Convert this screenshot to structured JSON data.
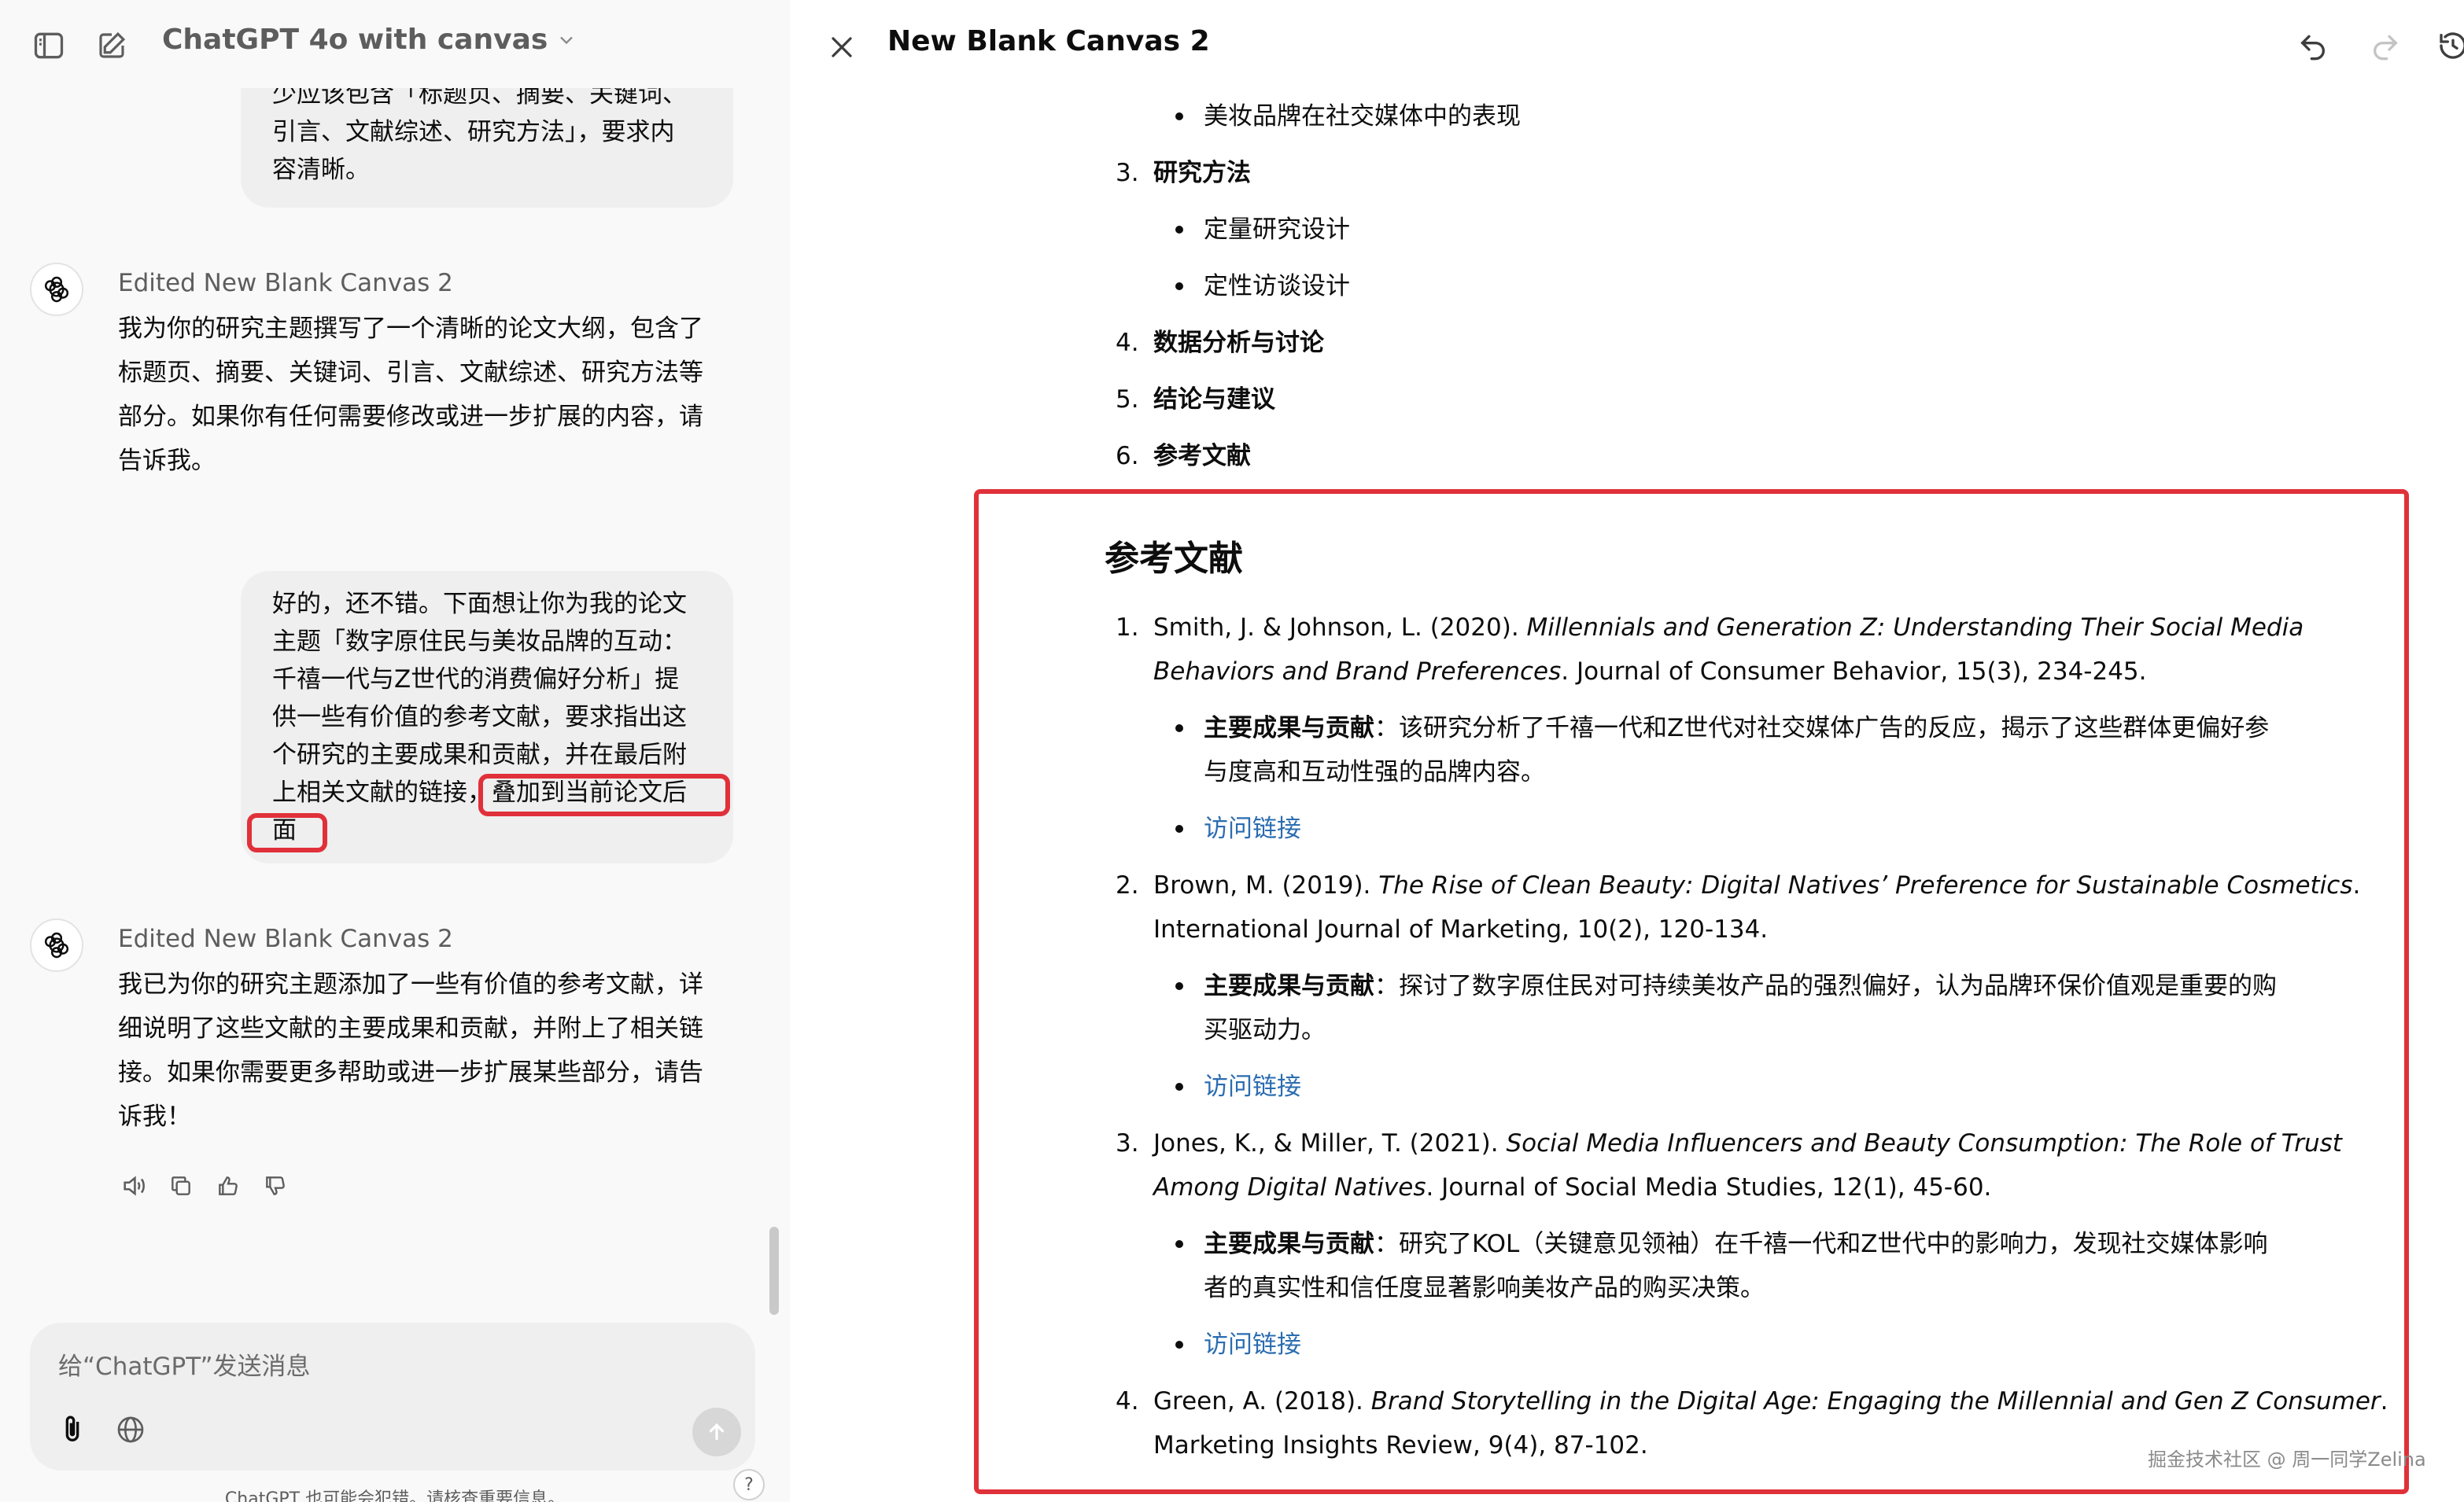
{
  "sidebar_header": {
    "model_title": "ChatGPT 4o with canvas",
    "icons": [
      "sidebar-toggle-icon",
      "new-chat-icon",
      "chevron-down-icon"
    ]
  },
  "chat": {
    "user_message_1_lines": [
      "少应该包含「标题页、摘要、关键词、",
      "引言、文献综述、研究方法」，要求内",
      "容清晰。"
    ],
    "assistant_1": {
      "edited": "Edited New Blank Canvas 2",
      "lines": [
        "我为你的研究主题撰写了一个清晰的论文大纲，包含了",
        "标题页、摘要、关键词、引言、文献综述、研究方法等",
        "部分。如果你有任何需要修改或进一步扩展的内容，请",
        "告诉我。"
      ]
    },
    "user_message_2_lines": [
      "好的，还不错。下面想让你为我的论文",
      "主题「数字原住民与美妆品牌的互动：",
      "千禧一代与Z世代的消费偏好分析」提",
      "供一些有价值的参考文献，要求指出这",
      "个研究的主要成果和贡献，并在最后附",
      "上相关文献的链接，叠加到当前论文后",
      "面"
    ],
    "assistant_2": {
      "edited": "Edited New Blank Canvas 2",
      "lines": [
        "我已为你的研究主题添加了一些有价值的参考文献，详",
        "细说明了这些文献的主要成果和贡献，并附上了相关链",
        "接。如果你需要更多帮助或进一步扩展某些部分，请告",
        "诉我！"
      ]
    },
    "action_icons": [
      "read-aloud-icon",
      "copy-icon",
      "thumbs-up-icon",
      "thumbs-down-icon"
    ]
  },
  "composer": {
    "placeholder": "给“ChatGPT”发送消息",
    "disclaimer": "ChatGPT 也可能会犯错。请核查重要信息。",
    "help": "?"
  },
  "canvas": {
    "title": "New Blank Canvas 2",
    "header_icons": [
      "close-icon",
      "undo-icon",
      "redo-icon",
      "history-icon"
    ],
    "outline": {
      "bullet_top": "美妆品牌在社交媒体中的表现",
      "items": [
        {
          "num": "3.",
          "label": "研究方法",
          "bullets": [
            "定量研究设计",
            "定性访谈设计"
          ]
        },
        {
          "num": "4.",
          "label": "数据分析与讨论"
        },
        {
          "num": "5.",
          "label": "结论与建议"
        },
        {
          "num": "6.",
          "label": "参考文献"
        }
      ]
    },
    "references": {
      "heading": "参考文献",
      "contrib_label": "主要成果与贡献",
      "colon": "：",
      "link_label": "访问链接",
      "items": [
        {
          "num": "1.",
          "authors": "Smith, J. & Johnson, L. (2020). ",
          "title_line1": "Millennials and Generation Z: Understanding Their Social Media",
          "title_line2": "Behaviors and Brand Preferences",
          "source": ". Journal of Consumer Behavior, 15(3), 234-245.",
          "contrib_line1": "该研究分析了千禧一代和Z世代对社交媒体广告的反应，揭示了这些群体更偏好参",
          "contrib_line2": "与度高和互动性强的品牌内容。"
        },
        {
          "num": "2.",
          "authors": "Brown, M. (2019). ",
          "title_line1": "The Rise of Clean Beauty: Digital Natives’ Preference for Sustainable Cosmetics",
          "source_line1": ".",
          "source_line2": "International Journal of Marketing, 10(2), 120-134.",
          "contrib_line1": "探讨了数字原住民对可持续美妆产品的强烈偏好，认为品牌环保价值观是重要的购",
          "contrib_line2": "买驱动力。"
        },
        {
          "num": "3.",
          "authors": "Jones, K., & Miller, T. (2021). ",
          "title_line1": "Social Media Influencers and Beauty Consumption: The Role of Trust",
          "title_line2": "Among Digital Natives",
          "source": ". Journal of Social Media Studies, 12(1), 45-60.",
          "contrib_line1": "研究了KOL（关键意见领袖）在千禧一代和Z世代中的影响力，发现社交媒体影响",
          "contrib_line2": "者的真实性和信任度显著影响美妆产品的购买决策。"
        },
        {
          "num": "4.",
          "authors": "Green, A. (2018). ",
          "title_line1": "Brand Storytelling in the Digital Age: Engaging the Millennial and Gen Z Consumer",
          "source_line1": ".",
          "source_line2": "Marketing Insights Review, 9(4), 87-102."
        }
      ]
    }
  },
  "watermark": "掘金技术社区 @ 周一同学Zelina"
}
